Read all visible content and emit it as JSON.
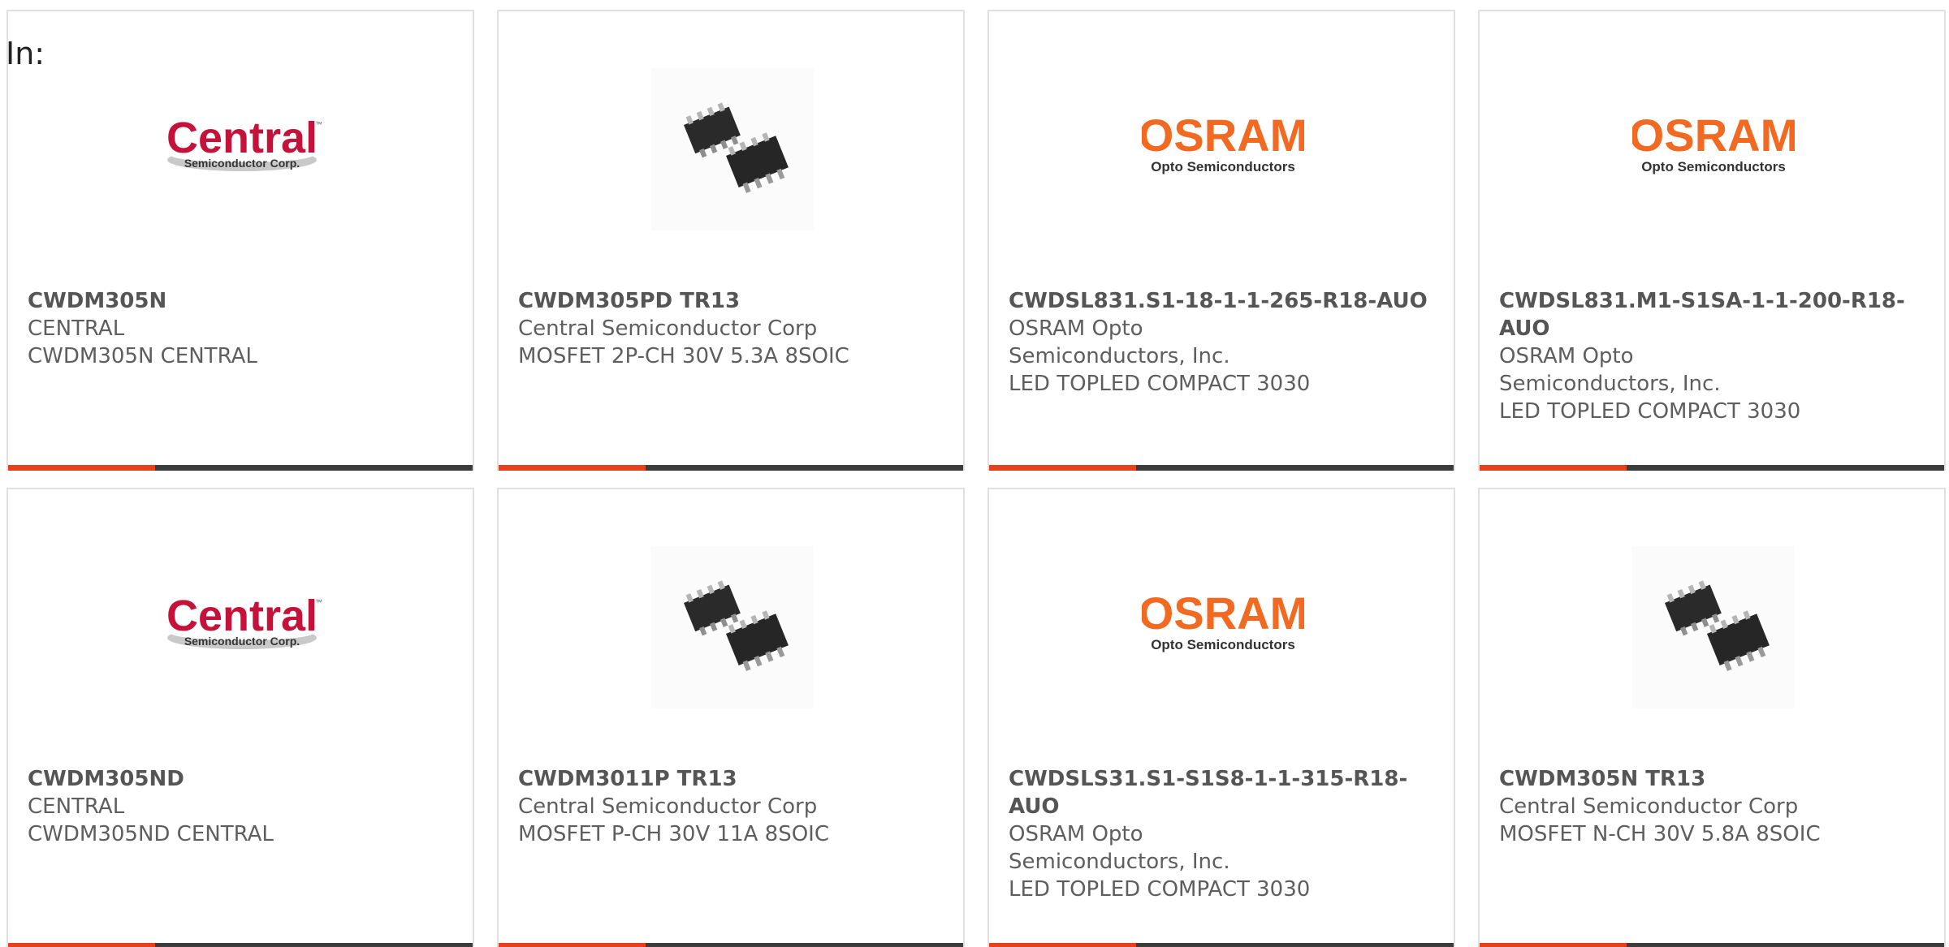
{
  "header": {
    "in_label": "In:"
  },
  "colors": {
    "accent": "#e8401c",
    "bar": "#3c3c3c",
    "border": "#e0e0e0"
  },
  "cards": [
    {
      "part_number": "CWDM305N",
      "manufacturer": "CENTRAL",
      "description": "CWDM305N CENTRAL",
      "image": "central-logo",
      "logo": {
        "word": "Central",
        "sub": "Semiconductor Corp.",
        "tm": "™"
      }
    },
    {
      "part_number": "CWDM305PD TR13",
      "manufacturer": "Central Semiconductor Corp",
      "description": "MOSFET 2P-CH 30V 5.3A 8SOIC",
      "image": "soic-8-chip"
    },
    {
      "part_number": "CWDSL831.S1-18-1-1-265-R18-AUO",
      "manufacturer": "OSRAM Opto Semiconductors, Inc.",
      "description": "LED TOPLED COMPACT 3030",
      "image": "osram-logo",
      "logo": {
        "word": "OSRAM",
        "sub": "Opto Semiconductors"
      }
    },
    {
      "part_number": "CWDSL831.M1-S1SA-1-1-200-R18-AUO",
      "manufacturer": "OSRAM Opto Semiconductors, Inc.",
      "description": "LED TOPLED COMPACT 3030",
      "image": "osram-logo",
      "logo": {
        "word": "OSRAM",
        "sub": "Opto Semiconductors"
      }
    },
    {
      "part_number": "CWDM305ND",
      "manufacturer": "CENTRAL",
      "description": "CWDM305ND CENTRAL",
      "image": "central-logo",
      "logo": {
        "word": "Central",
        "sub": "Semiconductor Corp.",
        "tm": "™"
      }
    },
    {
      "part_number": "CWDM3011P TR13",
      "manufacturer": "Central Semiconductor Corp",
      "description": "MOSFET P-CH 30V 11A 8SOIC",
      "image": "soic-8-chip"
    },
    {
      "part_number": "CWDSLS31.S1-S1S8-1-1-315-R18-AUO",
      "manufacturer": "OSRAM Opto Semiconductors, Inc.",
      "description": "LED TOPLED COMPACT 3030",
      "image": "osram-logo",
      "logo": {
        "word": "OSRAM",
        "sub": "Opto Semiconductors"
      }
    },
    {
      "part_number": "CWDM305N TR13",
      "manufacturer": "Central Semiconductor Corp",
      "description": "MOSFET N-CH 30V 5.8A 8SOIC",
      "image": "soic-8-chip"
    }
  ]
}
